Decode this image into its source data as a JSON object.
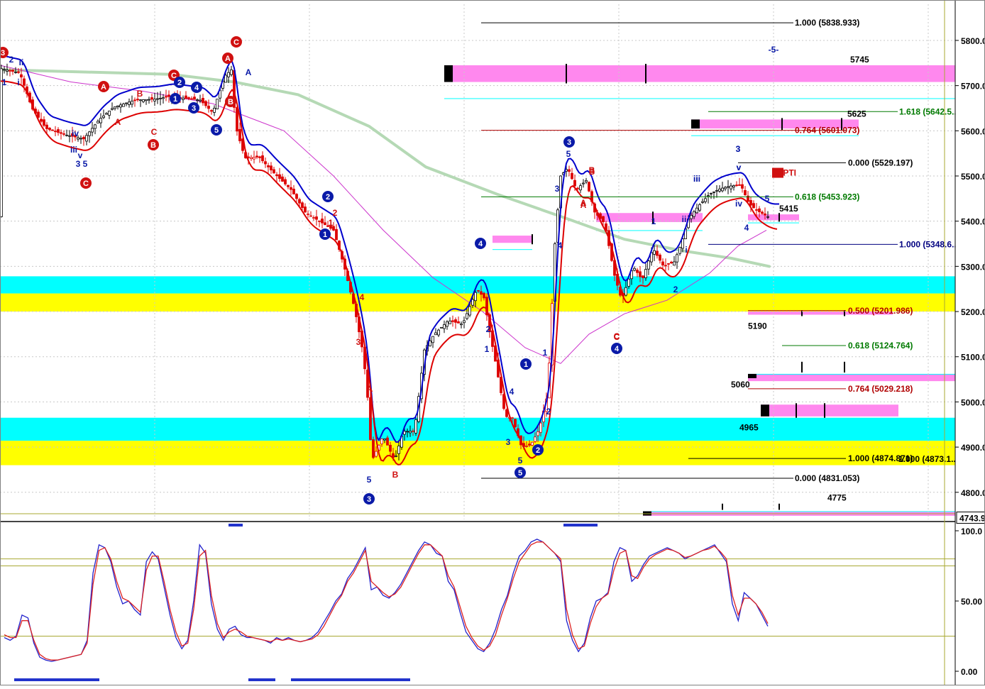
{
  "colors": {
    "background": "#ffffff",
    "cyan_zone": "#00ffff",
    "yellow_zone": "#ffff00",
    "magenta_zone": "#ff88ee",
    "upper_band": "#0000cc",
    "lower_band": "#dd0000",
    "long_ma": "#b5d9b5",
    "mid_ma": "#cc33cc",
    "stoch_k": "#2222cc",
    "stoch_d": "#dd2222",
    "olive_line": "#a8a832",
    "wave_circle_blue": "#0a1aa8",
    "wave_circle_red": "#d01010"
  },
  "chart_data": [
    {
      "type": "candlestick",
      "ylim": [
        4740,
        5880
      ],
      "yticks": [
        "5800.0",
        "5700.0",
        "5600.0",
        "5500.0",
        "5400.0",
        "5300.0",
        "5200.0",
        "5100.0",
        "5000.0",
        "4900.0",
        "4800.0"
      ],
      "last_price_label": "4743.9",
      "zones": [
        {
          "name": "cyan-zone-upper",
          "color": "cyan",
          "y": [
            5240,
            5278
          ]
        },
        {
          "name": "yellow-zone-upper",
          "color": "yellow",
          "y": [
            5200,
            5240
          ]
        },
        {
          "name": "cyan-zone-lower",
          "color": "cyan",
          "y": [
            4914,
            4965
          ]
        },
        {
          "name": "yellow-zone-lower",
          "color": "yellow",
          "y": [
            4860,
            4914
          ]
        }
      ],
      "fib_levels": [
        {
          "text": "1.000 (5838.933)",
          "y": 5838.9,
          "color": "#000000"
        },
        {
          "text": "1.618 (5642.5...",
          "y": 5642.5,
          "color": "#007a00"
        },
        {
          "text": "0.764 (5601.073)",
          "y": 5601.1,
          "color": "#b00000"
        },
        {
          "text": "0.000 (5529.197)",
          "y": 5529.2,
          "color": "#000000"
        },
        {
          "text": "0.618 (5453.923)",
          "y": 5453.9,
          "color": "#007a00"
        },
        {
          "text": "1.000 (5348.6...",
          "y": 5348.6,
          "color": "#000080"
        },
        {
          "text": "0.500 (5201.986)",
          "y": 5202.0,
          "color": "#b00000"
        },
        {
          "text": "0.618 (5124.764)",
          "y": 5124.8,
          "color": "#007a00"
        },
        {
          "text": "0.764 (5029.218)",
          "y": 5029.2,
          "color": "#b00000"
        },
        {
          "text": "1.000 (4874.871)",
          "y": 4874.9,
          "color": "#000000"
        },
        {
          "text": "0.000 (4831.053)",
          "y": 4831.1,
          "color": "#000000"
        }
      ],
      "fib_overlap_text": "1.000 (4873.1...",
      "price_labels": [
        {
          "text": "5745",
          "y": 5745
        },
        {
          "text": "5625",
          "y": 5625
        },
        {
          "text": "5415",
          "y": 5415
        },
        {
          "text": "5190",
          "y": 5190
        },
        {
          "text": "5060",
          "y": 5060
        },
        {
          "text": "4965",
          "y": 4965
        },
        {
          "text": "4775",
          "y": 4775
        }
      ],
      "pti_label": "54PTI",
      "wave_circles": [
        {
          "t": "3",
          "c": "red"
        },
        {
          "t": "C",
          "c": "red"
        },
        {
          "t": "A",
          "c": "red"
        },
        {
          "t": "C",
          "c": "red"
        },
        {
          "t": "A",
          "c": "red"
        },
        {
          "t": "C",
          "c": "red"
        },
        {
          "t": "B",
          "c": "red"
        },
        {
          "t": "B",
          "c": "red"
        },
        {
          "t": "2",
          "c": "blue"
        },
        {
          "t": "4",
          "c": "blue"
        },
        {
          "t": "1",
          "c": "blue"
        },
        {
          "t": "3",
          "c": "blue"
        },
        {
          "t": "5",
          "c": "blue"
        },
        {
          "t": "2",
          "c": "blue"
        },
        {
          "t": "1",
          "c": "blue"
        },
        {
          "t": "3",
          "c": "blue"
        },
        {
          "t": "4",
          "c": "blue"
        },
        {
          "t": "1",
          "c": "blue"
        },
        {
          "t": "2",
          "c": "blue"
        },
        {
          "t": "5",
          "c": "blue"
        },
        {
          "t": "3",
          "c": "blue"
        },
        {
          "t": "4",
          "c": "blue"
        }
      ],
      "wave_labels": [
        "1",
        "2",
        "ii",
        "i",
        "iv",
        "iii",
        "v",
        "3",
        "5",
        "A",
        "B",
        "C",
        "A",
        "A",
        "B",
        "1",
        "2",
        "4",
        "3",
        "5",
        "A",
        "B",
        "C",
        "1",
        "2",
        "3",
        "4",
        "5",
        "1",
        "2",
        "3",
        "4",
        "5",
        "A",
        "B",
        "C",
        "1",
        "i",
        "ii",
        "iii",
        "iv",
        "v",
        "2",
        "3",
        "4",
        "5",
        "-5-",
        "3",
        "v",
        "iii"
      ]
    },
    {
      "type": "line",
      "ylim": [
        0,
        100
      ],
      "yticks": [
        "100.0",
        "50.00",
        "0.00"
      ],
      "bands": [
        80,
        75,
        25
      ],
      "series": [
        {
          "role": "stoch_k",
          "values": [
            24,
            22,
            25,
            40,
            38,
            20,
            10,
            8,
            7,
            8,
            9,
            10,
            11,
            12,
            22,
            70,
            90,
            88,
            78,
            60,
            48,
            50,
            44,
            40,
            78,
            85,
            80,
            60,
            40,
            24,
            16,
            22,
            50,
            90,
            84,
            48,
            30,
            22,
            30,
            32,
            26,
            24,
            24,
            23,
            22,
            20,
            24,
            22,
            24,
            22,
            21,
            22,
            24,
            28,
            35,
            42,
            50,
            55,
            66,
            72,
            80,
            88,
            58,
            60,
            54,
            52,
            56,
            62,
            70,
            78,
            86,
            92,
            90,
            84,
            82,
            64,
            58,
            42,
            28,
            22,
            16,
            14,
            20,
            30,
            44,
            54,
            70,
            82,
            86,
            92,
            94,
            92,
            88,
            84,
            78,
            36,
            22,
            14,
            20,
            38,
            50,
            52,
            56,
            78,
            88,
            86,
            64,
            68,
            76,
            82,
            84,
            86,
            88,
            86,
            84,
            80,
            82,
            84,
            86,
            88,
            90,
            84,
            78,
            48,
            36,
            56,
            52,
            48,
            40,
            32
          ]
        },
        {
          "role": "stoch_d",
          "values": [
            26,
            24,
            24,
            36,
            36,
            22,
            12,
            9,
            8,
            8,
            9,
            10,
            11,
            12,
            20,
            62,
            86,
            88,
            80,
            64,
            52,
            50,
            46,
            42,
            72,
            82,
            82,
            64,
            44,
            28,
            18,
            20,
            44,
            82,
            86,
            54,
            34,
            24,
            28,
            30,
            28,
            25,
            24,
            23,
            22,
            21,
            23,
            22,
            23,
            22,
            21,
            22,
            23,
            26,
            32,
            40,
            48,
            54,
            64,
            70,
            78,
            86,
            64,
            60,
            56,
            53,
            55,
            60,
            68,
            76,
            84,
            90,
            90,
            86,
            82,
            68,
            60,
            46,
            32,
            24,
            18,
            15,
            18,
            26,
            40,
            52,
            66,
            78,
            84,
            90,
            92,
            92,
            88,
            84,
            80,
            44,
            26,
            16,
            18,
            34,
            46,
            52,
            55,
            72,
            84,
            86,
            68,
            66,
            74,
            80,
            83,
            85,
            87,
            86,
            84,
            81,
            82,
            84,
            86,
            87,
            89,
            85,
            80,
            54,
            40,
            52,
            52,
            48,
            42,
            34
          ]
        }
      ]
    }
  ]
}
